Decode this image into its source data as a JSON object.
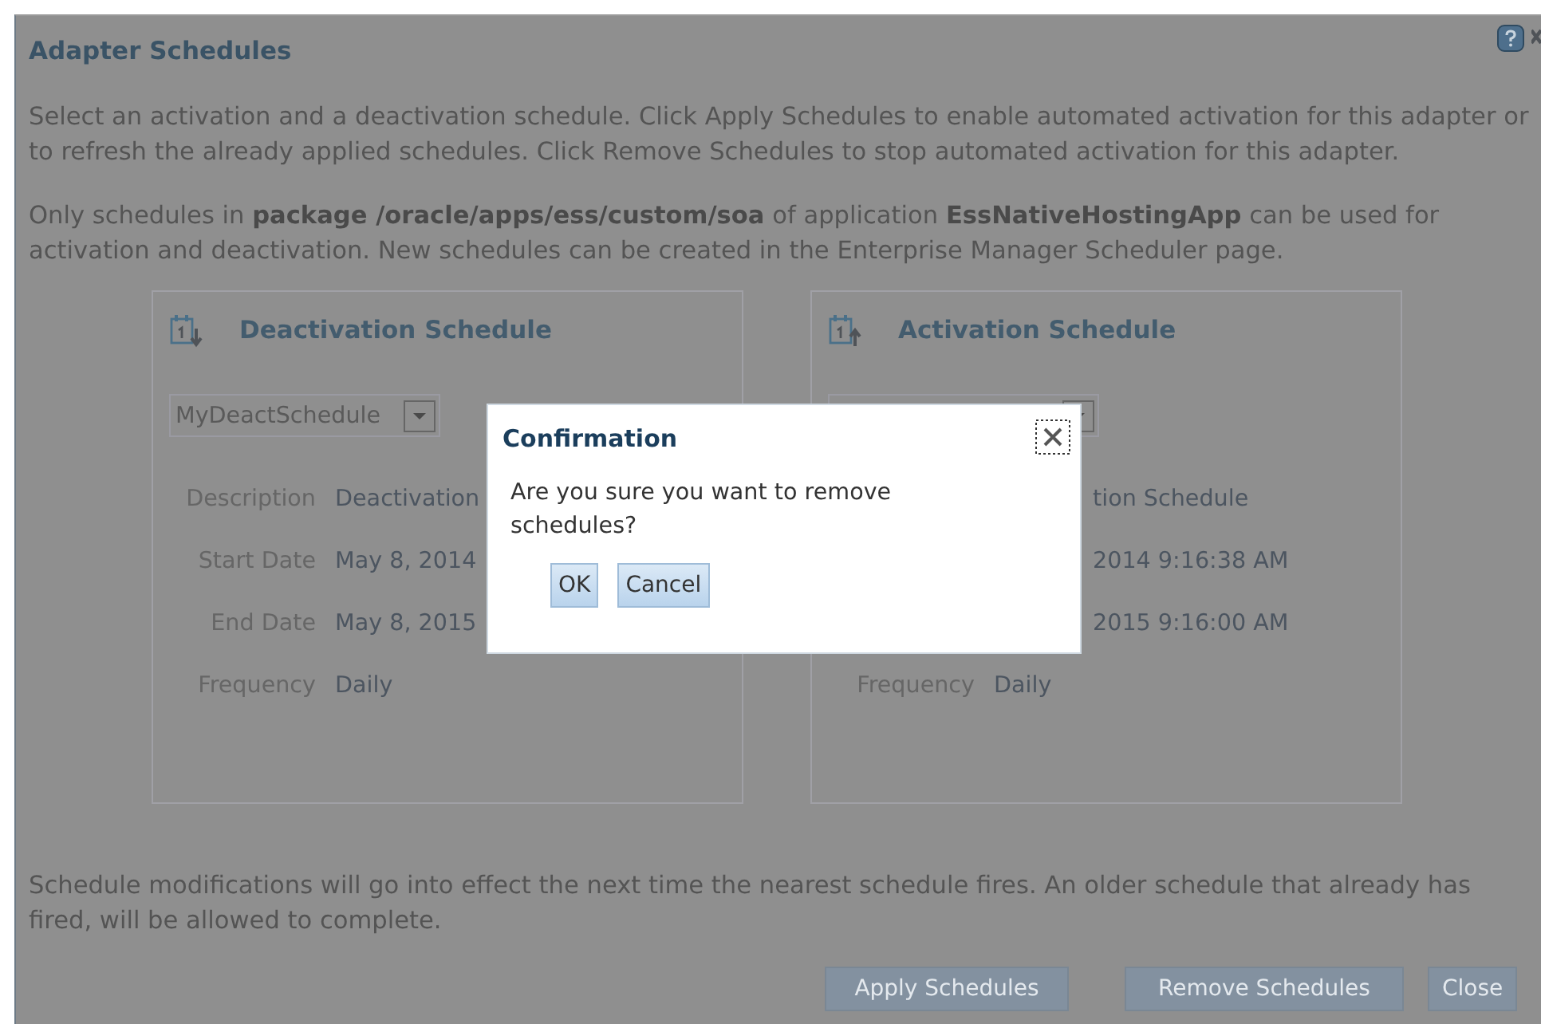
{
  "window": {
    "title": "Adapter Schedules"
  },
  "instructions": [
    "Select an activation and a deactivation schedule. Click Apply Schedules to enable automated activation for this adapter or to refresh the already applied schedules. Click Remove Schedules to stop automated activation for this adapter.",
    "Only schedules in **package /oracle/apps/ess/custom/soa** of application **EssNativeHostingApp** can be used for activation and deactivation. New schedules can be created in the Enterprise Manager Scheduler page."
  ],
  "panels": [
    {
      "kind": "deactivation",
      "title": "Deactivation Schedule",
      "dropdown": {
        "value": "MyDeactSchedule"
      },
      "rows": [
        {
          "label": "Description",
          "value": "Deactivation"
        },
        {
          "label": "Start Date",
          "value": "May 8, 2014"
        },
        {
          "label": "End Date",
          "value": "May 8, 2015"
        },
        {
          "label": "Frequency",
          "value": "Daily"
        }
      ]
    },
    {
      "kind": "activation",
      "title": "Activation Schedule",
      "rows": [
        {
          "value": "tion Schedule"
        },
        {
          "value": "2014 9:16:38 AM"
        },
        {
          "value": "2015 9:16:00 AM"
        },
        {
          "label": "Frequency",
          "value": "Daily"
        }
      ]
    }
  ],
  "note": "Schedule modifications will go into effect the next time the nearest schedule fires. An older schedule that already has fired, will be allowed to complete.",
  "buttons": [
    {
      "label": "Apply Schedules"
    },
    {
      "label": "Remove Schedules"
    },
    {
      "label": "Close"
    }
  ],
  "dialog": {
    "title": "Confirmation",
    "message": "Are you sure you want to remove schedules?",
    "buttons": [
      "OK",
      "Cancel"
    ]
  }
}
